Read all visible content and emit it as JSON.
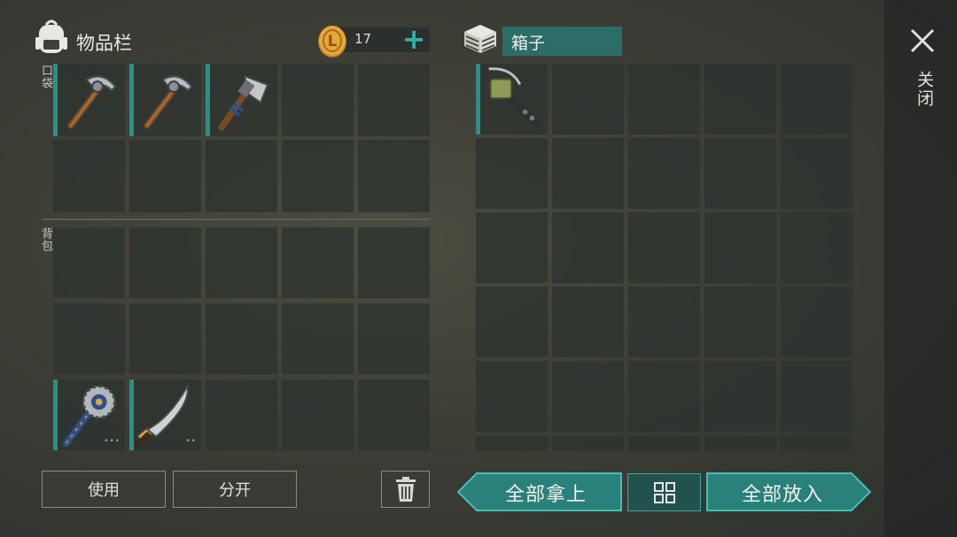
{
  "inventory": {
    "title": "物品栏",
    "pocket_label": "口袋",
    "backpack_label": "背包",
    "coins": "17",
    "coin_symbol": "L",
    "plus": "+",
    "pocket_slots": [
      {
        "item": "pickaxe"
      },
      {
        "item": "pickaxe"
      },
      {
        "item": "hatchet"
      },
      {
        "item": null
      },
      {
        "item": null
      },
      {
        "item": null
      },
      {
        "item": null
      },
      {
        "item": null
      },
      {
        "item": null
      },
      {
        "item": null
      }
    ],
    "backpack_slots": [
      {
        "item": null
      },
      {
        "item": null
      },
      {
        "item": null
      },
      {
        "item": null
      },
      {
        "item": null
      },
      {
        "item": null
      },
      {
        "item": null
      },
      {
        "item": null
      },
      {
        "item": null
      },
      {
        "item": null
      },
      {
        "item": "saw-mace",
        "dots": "•••"
      },
      {
        "item": "machete",
        "dots": "••"
      },
      {
        "item": null
      },
      {
        "item": null
      },
      {
        "item": null
      }
    ]
  },
  "box": {
    "title": "箱子",
    "slots": [
      {
        "item": "crossbow"
      },
      {
        "item": null
      },
      {
        "item": null
      },
      {
        "item": null
      },
      {
        "item": null
      },
      {
        "item": null
      },
      {
        "item": null
      },
      {
        "item": null
      },
      {
        "item": null
      },
      {
        "item": null
      },
      {
        "item": null
      },
      {
        "item": null
      },
      {
        "item": null
      },
      {
        "item": null
      },
      {
        "item": null
      },
      {
        "item": null
      },
      {
        "item": null
      },
      {
        "item": null
      },
      {
        "item": null
      },
      {
        "item": null
      },
      {
        "item": null
      },
      {
        "item": null
      },
      {
        "item": null
      },
      {
        "item": null
      },
      {
        "item": null
      }
    ]
  },
  "buttons": {
    "use": "使用",
    "split": "分开",
    "take_all": "全部拿上",
    "put_all": "全部放入",
    "close_label": "关闭"
  },
  "colors": {
    "accent": "#2fb3a6",
    "teal_button": "#2a807a",
    "name_box": "#2c6d68",
    "slot_marker": "#2b8f87"
  },
  "icons": [
    "backpack-icon",
    "coin-icon",
    "plus-icon",
    "box-icon",
    "close-icon",
    "trash-icon",
    "sort-grid-icon",
    "pickaxe-icon",
    "hatchet-icon",
    "saw-mace-icon",
    "machete-icon",
    "crossbow-icon"
  ]
}
